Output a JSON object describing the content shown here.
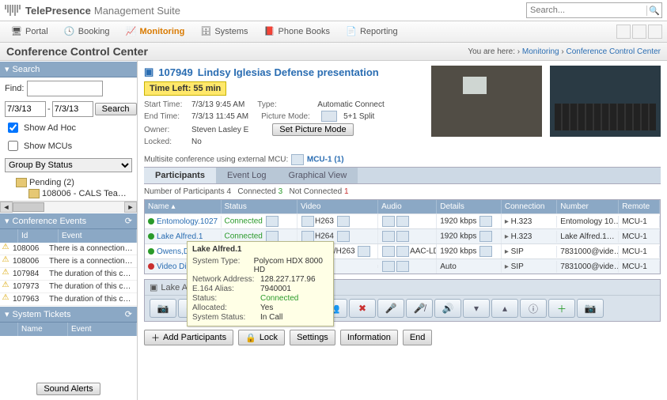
{
  "brand": {
    "tp": "TelePresence",
    "ms": "Management Suite",
    "cisco": "cisco"
  },
  "search": {
    "placeholder": "Search..."
  },
  "nav": {
    "portal": "Portal",
    "booking": "Booking",
    "monitoring": "Monitoring",
    "systems": "Systems",
    "phonebooks": "Phone Books",
    "reporting": "Reporting"
  },
  "crumb": {
    "title": "Conference Control Center",
    "here_lbl": "You are here:",
    "monitoring": "Monitoring",
    "ccc": "Conference Control Center"
  },
  "left": {
    "search_hdr": "Search",
    "find_lbl": "Find:",
    "date_from": "7/3/13",
    "date_to": "7/3/13",
    "search_btn": "Search",
    "show_adhoc": "Show Ad Hoc",
    "show_mcus": "Show MCUs",
    "group_by": "Group By Status",
    "tree": {
      "pending": "Pending (2)",
      "n1": "108006 - CALS Tea…",
      "n2": "…"
    },
    "conf_events_hdr": "Conference Events",
    "col_id": "Id",
    "col_event": "Event",
    "events": [
      {
        "id": "108006",
        "txt": "There is a connection…"
      },
      {
        "id": "108006",
        "txt": "There is a connection…"
      },
      {
        "id": "107984",
        "txt": "The duration of this c…"
      },
      {
        "id": "107973",
        "txt": "The duration of this c…"
      },
      {
        "id": "107963",
        "txt": "The duration of this c…"
      }
    ],
    "sys_tickets_hdr": "System Tickets",
    "col_name": "Name",
    "col_event2": "Event",
    "sound_alerts": "Sound Alerts"
  },
  "conf": {
    "id": "107949",
    "title": "Lindsy Iglesias Defense presentation",
    "timeleft": "Time Left: 55 min",
    "start_lbl": "Start Time:",
    "start": "7/3/13 9:45 AM",
    "end_lbl": "End Time:",
    "end": "7/3/13 11:45 AM",
    "owner_lbl": "Owner:",
    "owner": "Steven Lasley E",
    "locked_lbl": "Locked:",
    "locked": "No",
    "type_lbl": "Type:",
    "type": "Automatic Connect",
    "pic_lbl": "Picture Mode:",
    "pic": "5+1 Split",
    "set_pic": "Set Picture Mode",
    "mcu_lbl": "Multisite conference using external MCU:",
    "mcu": "MCU-1 (1)"
  },
  "tabs": {
    "participants": "Participants",
    "eventlog": "Event Log",
    "graphical": "Graphical View"
  },
  "counts": {
    "num_lbl": "Number of Participants",
    "num": "4",
    "conn_lbl": "Connected",
    "conn": "3",
    "nc_lbl": "Not Connected",
    "nc": "1"
  },
  "pcols": {
    "name": "Name",
    "status": "Status",
    "video": "Video",
    "audio": "Audio",
    "details": "Details",
    "conn": "Connection",
    "number": "Number",
    "remote": "Remote"
  },
  "prows": [
    {
      "name": "Entomology.1027",
      "status": "Connected",
      "video": "H263",
      "audio": "",
      "details": "1920 kbps",
      "conn": "H.323",
      "number": "Entomology 10…",
      "remote": "MCU-1"
    },
    {
      "name": "Lake Alfred.1",
      "status": "Connected",
      "video": "H264",
      "audio": "",
      "details": "1920 kbps",
      "conn": "H.323",
      "number": "Lake Alfred.1…",
      "remote": "MCU-1"
    },
    {
      "name": "Owens,David P",
      "status": "Connected",
      "video": "H264/H263",
      "audio": "AAC-LD",
      "details": "1920 kbps",
      "conn": "SIP",
      "number": "7831000@vide…",
      "remote": "MCU-1"
    },
    {
      "name": "Video Dial",
      "status": "",
      "video": "",
      "audio": "",
      "details": "Auto",
      "conn": "SIP",
      "number": "7831000@vide…",
      "remote": "MCU-1"
    }
  ],
  "tooltip": {
    "title": "Lake Alfred.1",
    "rows": [
      {
        "l": "System Type:",
        "v": "Polycom HDX 8000 HD"
      },
      {
        "l": "Network Address:",
        "v": "128.227.177.96"
      },
      {
        "l": "E.164 Alias:",
        "v": "7940001"
      },
      {
        "l": "Status:",
        "v": "Connected",
        "green": true
      },
      {
        "l": "Allocated:",
        "v": "Yes"
      },
      {
        "l": "System Status:",
        "v": "In Call"
      }
    ]
  },
  "selected_participant": "Lake Alfred.1",
  "bottom": {
    "add": "Add Participants",
    "lock": "Lock",
    "settings": "Settings",
    "info": "Information",
    "end": "End"
  }
}
